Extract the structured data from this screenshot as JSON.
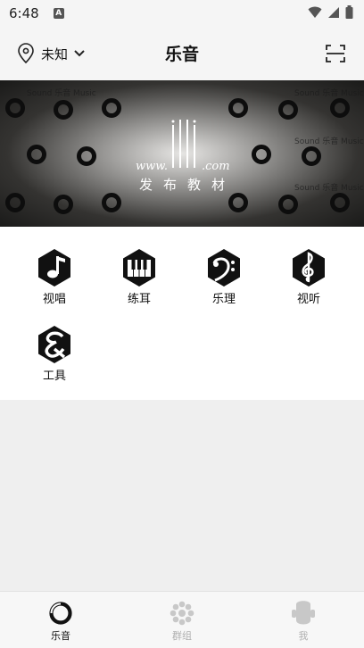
{
  "status_bar": {
    "time": "6:48",
    "badge": "A"
  },
  "header": {
    "location": "未知",
    "title": "乐音"
  },
  "banner": {
    "url_text": "www.",
    "url_suffix": ".com",
    "caption": "发布教材",
    "watermark": "Sound 乐音 Music"
  },
  "grid": {
    "items": [
      {
        "label": "视唱",
        "icon": "music-note-icon"
      },
      {
        "label": "练耳",
        "icon": "piano-keys-icon"
      },
      {
        "label": "乐理",
        "icon": "bass-clef-icon"
      },
      {
        "label": "视听",
        "icon": "treble-clef-icon"
      },
      {
        "label": "工具",
        "icon": "ampersand-tool-icon"
      }
    ]
  },
  "bottom_nav": {
    "items": [
      {
        "label": "乐音",
        "active": true
      },
      {
        "label": "群组",
        "active": false
      },
      {
        "label": "我",
        "active": false
      }
    ],
    "active_color": "#111111",
    "inactive_color": "#c8c8c8"
  }
}
